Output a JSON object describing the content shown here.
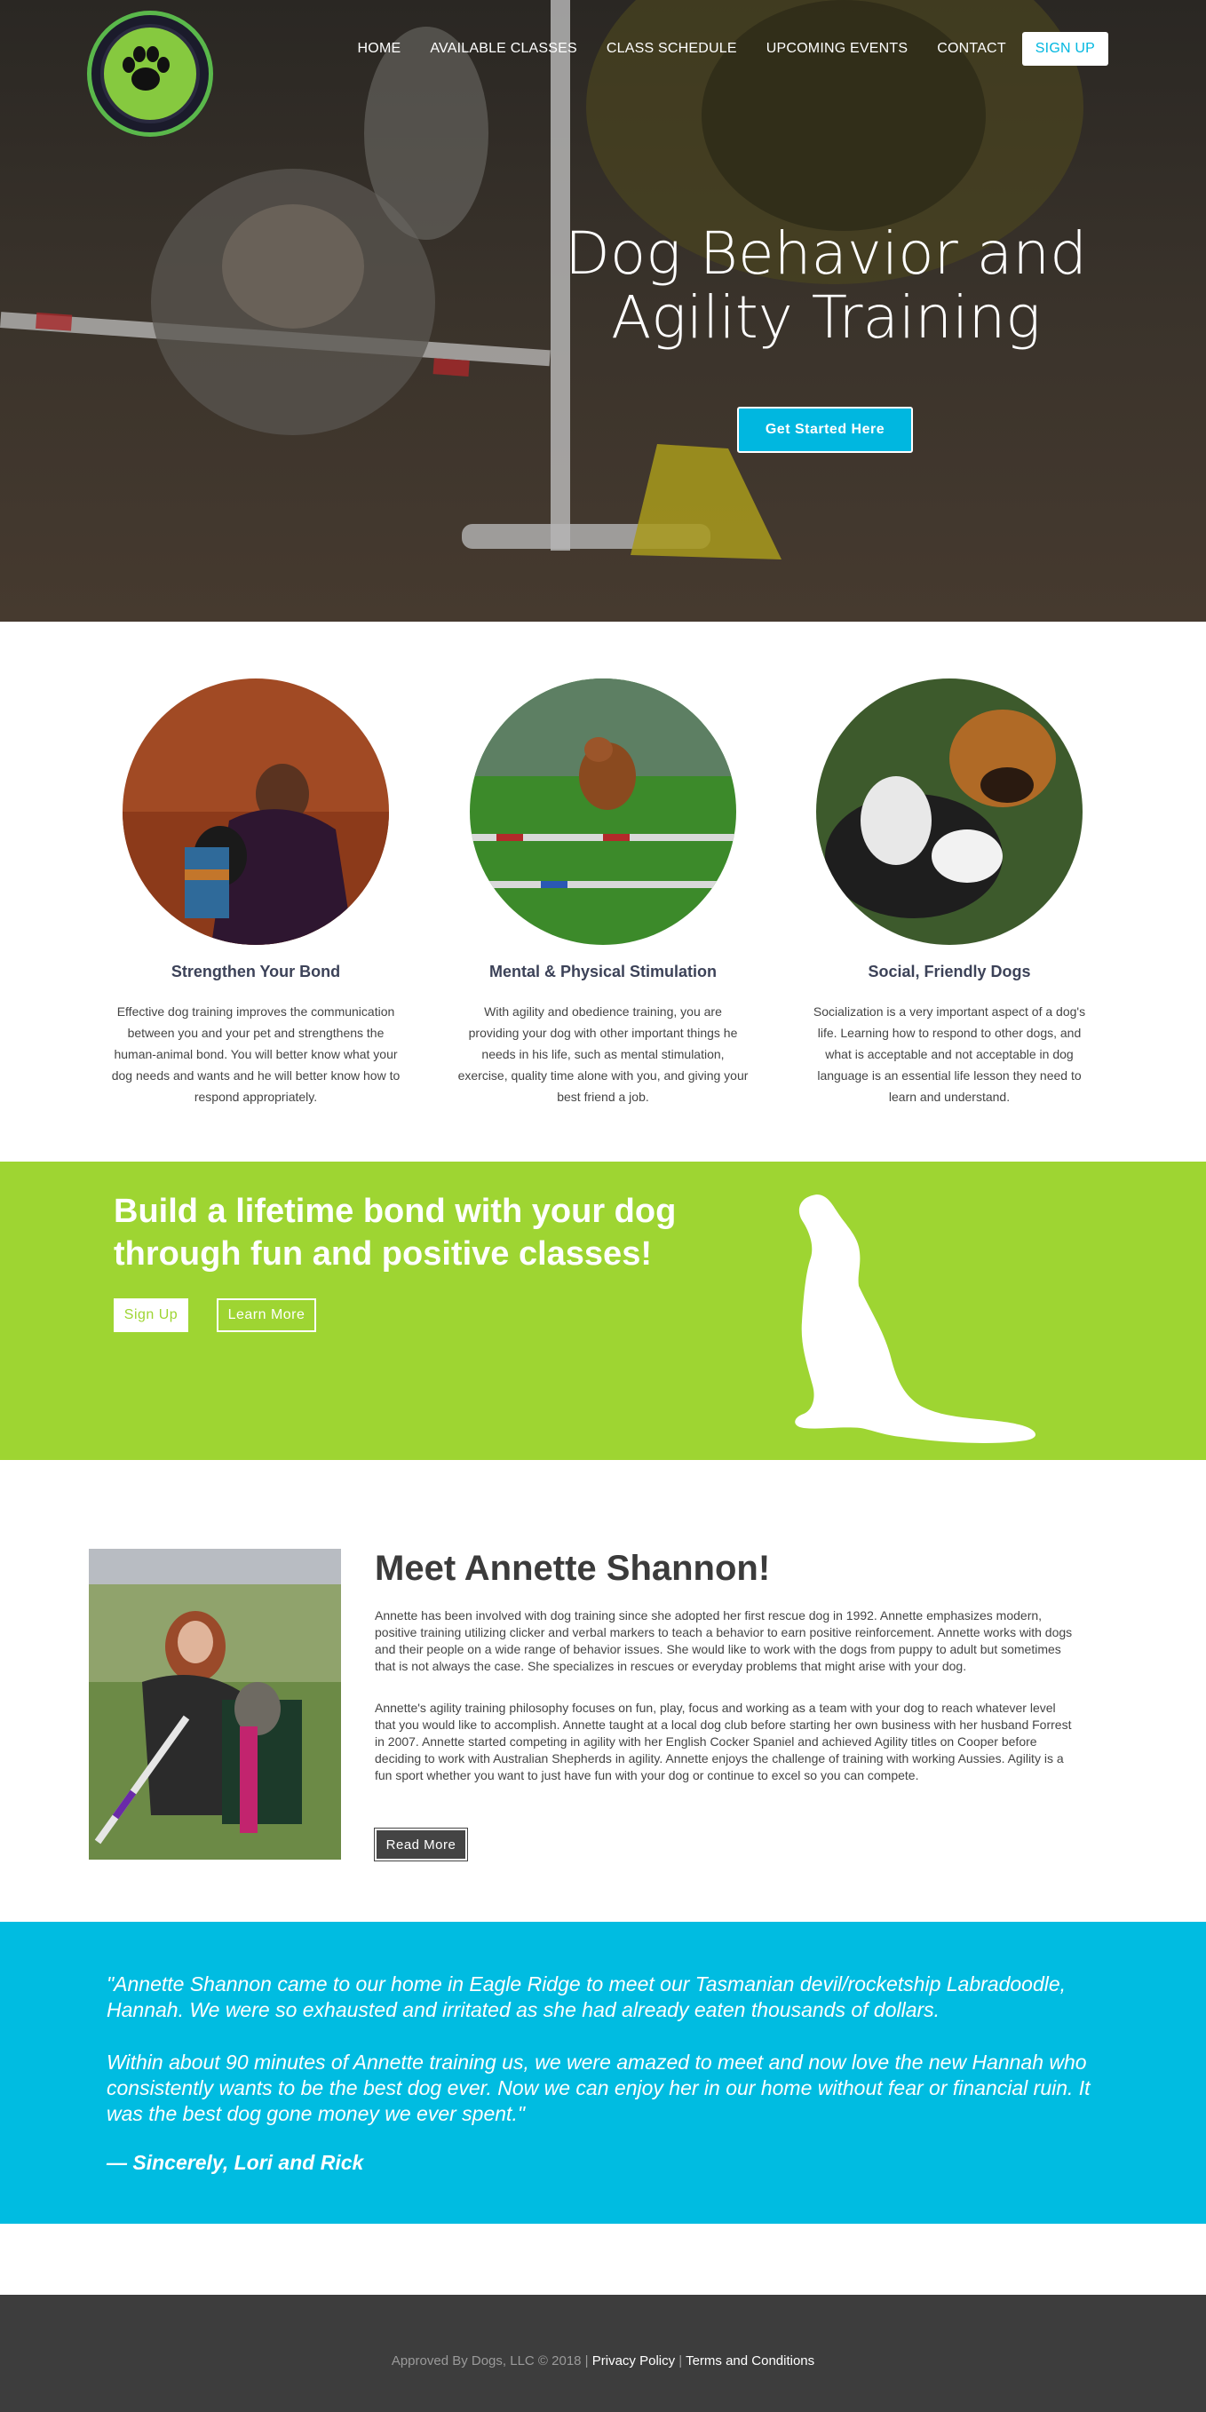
{
  "brand": {
    "logo_text": "APPROVED BY DOGS, LLC",
    "accent": "#00b7e0",
    "green": "#9ed532"
  },
  "nav": {
    "items": [
      "HOME",
      "AVAILABLE CLASSES",
      "CLASS SCHEDULE",
      "UPCOMING EVENTS",
      "CONTACT"
    ],
    "signup": "SIGN UP"
  },
  "hero": {
    "title_line1": "Dog Behavior and",
    "title_line2": "Agility Training",
    "cta": "Get Started Here"
  },
  "features": [
    {
      "title": "Strengthen Your Bond",
      "text": "Effective dog training improves the communication between you and your pet and strengthens the human-animal bond. You will better know what your dog needs and wants and he will better know how to respond appropriately."
    },
    {
      "title": "Mental & Physical Stimulation",
      "text": "With agility and obedience training, you are providing your dog with other important things he needs in his life, such as mental stimulation, exercise, quality time alone with you, and giving your best friend a job."
    },
    {
      "title": "Social, Friendly Dogs",
      "text": "Socialization is a very important aspect of a dog's life. Learning how to respond to other dogs, and what is acceptable and not acceptable in dog language is an essential life lesson they need to learn and understand."
    }
  ],
  "band": {
    "headline": "Build a lifetime bond with your dog through fun and positive classes!",
    "signup": "Sign Up",
    "learn_more": "Learn More"
  },
  "about": {
    "title": "Meet Annette Shannon!",
    "p1": "Annette has been involved with dog training since she adopted her first rescue dog in 1992. Annette emphasizes modern, positive training utilizing clicker and verbal markers to teach a behavior to earn positive reinforcement. Annette works with dogs and their people on a wide range of behavior issues. She would like to work with the dogs from puppy to adult but sometimes that is not always the case. She specializes in rescues or everyday problems that might arise with your dog.",
    "p2": "Annette's agility training philosophy focuses on fun, play, focus and working as a team with your dog to reach whatever level that you would like to accomplish. Annette taught at a local dog club before starting her own business with her husband Forrest in 2007. Annette started competing in agility with her English Cocker Spaniel and achieved Agility titles on Cooper before deciding to work with Australian Shepherds in agility. Annette enjoys the challenge of training with working Aussies. Agility is a fun sport whether you want to just have fun with your dog or continue to excel so you can compete.",
    "read_more": "Read More"
  },
  "testimonial": {
    "q1": "\"Annette Shannon came to our home in Eagle Ridge to meet our Tasmanian devil/rocketship Labradoodle, Hannah. We were so exhausted and irritated as she had already eaten thousands of dollars.",
    "q2": "Within about 90 minutes of Annette training us, we were amazed to meet and now love the new Hannah who consistently wants to be the best dog ever. Now we can enjoy her in our home without fear or financial ruin. It was the best dog gone money we ever spent.\"",
    "signature": "— Sincerely, Lori and Rick"
  },
  "footer": {
    "copyright": "Approved By Dogs, LLC © 2018 | ",
    "privacy": "Privacy Policy",
    "sep": " | ",
    "terms": "Terms and Conditions"
  }
}
